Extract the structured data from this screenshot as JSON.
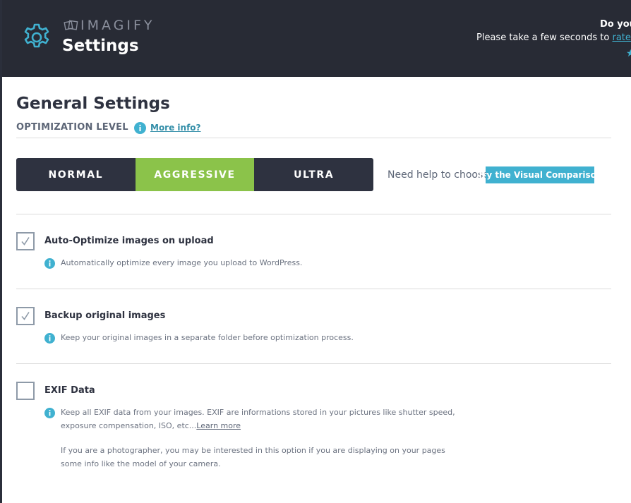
{
  "header": {
    "brand": "IMAGIFY",
    "title": "Settings",
    "rate_question": "Do you",
    "rate_prefix": "Please take a few seconds to ",
    "rate_link": "rate it on",
    "rate_star": "★"
  },
  "general": {
    "title": "General Settings",
    "optimization_level_label": "OPTIMIZATION LEVEL",
    "more_info": "More info?",
    "levels": [
      {
        "label": "NORMAL",
        "active": false
      },
      {
        "label": "AGGRESSIVE",
        "active": true
      },
      {
        "label": "ULTRA",
        "active": false
      }
    ],
    "help_text": "Need help to choose?",
    "compare_button": "Try the Visual Comparison"
  },
  "options": [
    {
      "title": "Auto-Optimize images on upload",
      "checked": true,
      "desc": "Automatically optimize every image you upload to WordPress."
    },
    {
      "title": "Backup original images",
      "checked": true,
      "desc": "Keep your original images in a separate folder before optimization process."
    },
    {
      "title": "EXIF Data",
      "checked": false,
      "desc_line1": "Keep all EXIF data from your images. EXIF are informations stored in your pictures like shutter speed,",
      "desc_line2": "exposure compensation, ISO, etc...",
      "learn_more": "Learn more",
      "desc_extra_line1": "If you are a photographer, you may be interested in this option if you are displaying on your pages",
      "desc_extra_line2": "some info like the model of your camera."
    }
  ],
  "colors": {
    "header_bg": "#282b35",
    "accent": "#40b1d0",
    "active_level": "#8bc34a",
    "level_bg": "#2e3240"
  }
}
